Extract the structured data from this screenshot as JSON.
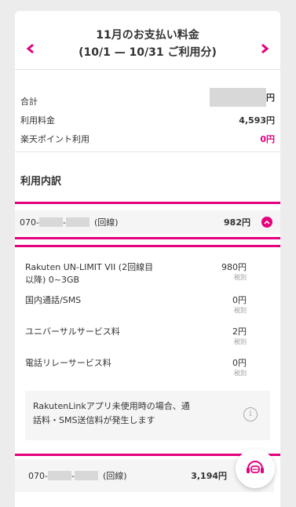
{
  "colors": {
    "accent": "#e5007d",
    "background": "#ececec",
    "card": "#ffffff"
  },
  "header": {
    "title_line1": "11月のお支払い料金",
    "title_line2": "(10/1 — 10/31 ご利用分)",
    "prev_icon": "chevron-left-icon",
    "next_icon": "chevron-right-icon"
  },
  "summary": {
    "total_label": "合計",
    "total_unit": "円",
    "usage_label": "利用料金",
    "usage_amount": "4,593円",
    "points_label": "楽天ポイント利用",
    "points_amount": "0円"
  },
  "breakdown": {
    "title": "利用内訳",
    "lines": [
      {
        "prefix": "070-",
        "separator": "-",
        "suffix": "(回線)",
        "amount": "982円",
        "expanded": true
      },
      {
        "prefix": "070-",
        "separator": "-",
        "suffix": "(回線)",
        "amount": "3,194円",
        "expanded": false
      }
    ],
    "items": [
      {
        "name": "Rakuten UN-LIMIT VII (2回線目以降) 0~3GB",
        "price": "980円",
        "tax": "税別"
      },
      {
        "name": "国内通話/SMS",
        "price": "0円",
        "tax": "税別"
      },
      {
        "name": "ユニバーサルサービス料",
        "price": "2円",
        "tax": "税別"
      },
      {
        "name": "電話リレーサービス料",
        "price": "0円",
        "tax": "税別"
      }
    ],
    "notice": "RakutenLinkアプリ未使用時の場合、通話料・SMS送信料が発生します",
    "notice_icon": "info-icon"
  },
  "chat": {
    "icon": "chat-support-icon"
  }
}
